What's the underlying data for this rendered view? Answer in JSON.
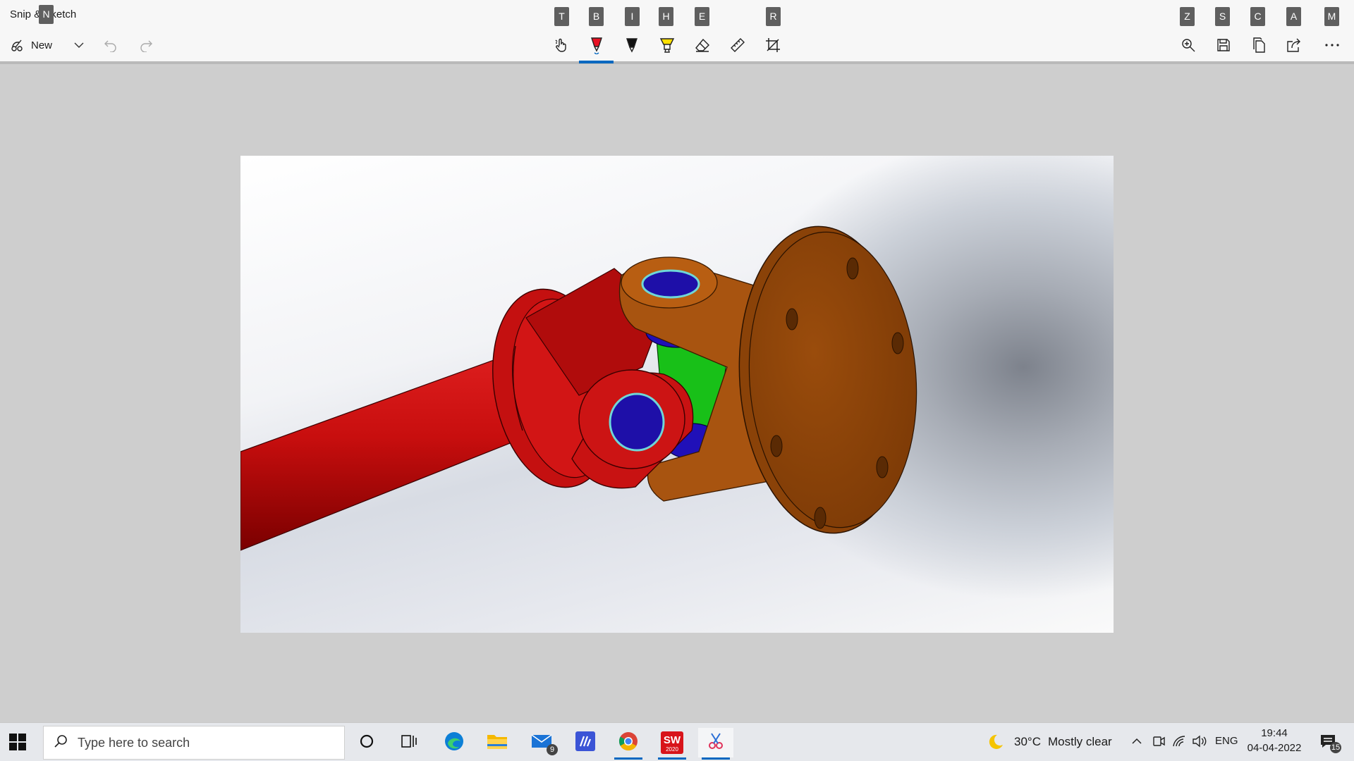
{
  "app": {
    "title": "Snip & Sketch"
  },
  "keytips": {
    "new": "N",
    "touch": "T",
    "ballpoint": "B",
    "pencil": "I",
    "highlighter": "H",
    "eraser": "E",
    "crop": "R",
    "zoom": "Z",
    "save": "S",
    "copy": "C",
    "share": "A",
    "more": "M"
  },
  "toolbar": {
    "new_label": "New"
  },
  "icons": {
    "new": "snip-icon",
    "dropdown": "chevron-down-icon",
    "undo": "undo-icon",
    "redo": "redo-icon",
    "touch": "touch-writing-icon",
    "ballpoint": "ballpoint-pen-icon",
    "pencil": "pencil-icon",
    "highlighter": "highlighter-icon",
    "eraser": "eraser-icon",
    "ruler": "ruler-icon",
    "crop": "crop-icon",
    "zoom": "zoom-icon",
    "save": "save-icon",
    "copy": "copy-icon",
    "share": "share-icon",
    "more": "more-icon"
  },
  "colors": {
    "accent": "#0067c0",
    "ballpoint": "#e81123",
    "highlighter": "#ffe000"
  },
  "taskbar": {
    "search_placeholder": "Type here to search",
    "mail_badge": "9",
    "weather": {
      "temp": "30°C",
      "desc": "Mostly clear"
    },
    "lang": "ENG",
    "time": "19:44",
    "date": "04-04-2022",
    "notifications": "15",
    "solidworks_label": "SW",
    "solidworks_sub": "2020"
  }
}
